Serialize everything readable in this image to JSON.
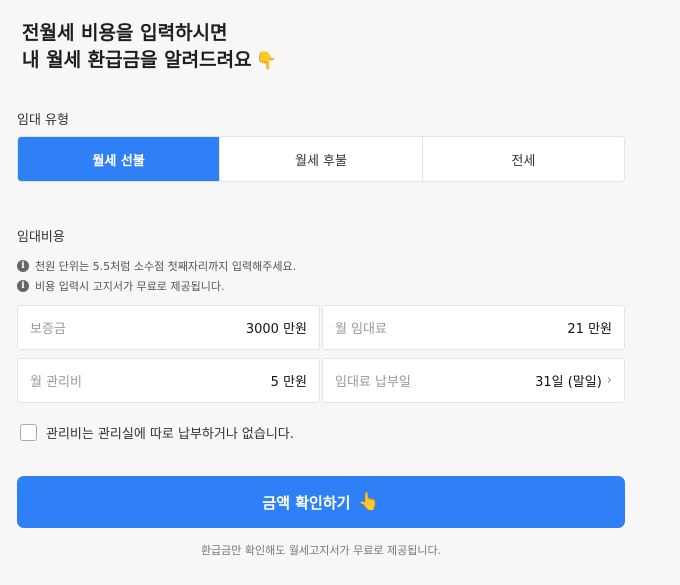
{
  "headline": {
    "line1": "전월세 비용을 입력하시면",
    "line2": "내 월세 환급금을 알려드려요",
    "emoji": "👇"
  },
  "rent_type": {
    "label": "임대 유형",
    "options": [
      "월세 선불",
      "월세 후불",
      "전세"
    ],
    "selected": "월세 선불"
  },
  "cost": {
    "label": "임대비용",
    "notes": [
      "천원 단위는 5.5처럼 소수점 첫째자리까지 입력해주세요.",
      "비용 입력시 고지서가 무료로 제공됩니다."
    ],
    "fields": {
      "deposit": {
        "label": "보증금",
        "value": "3000 만원"
      },
      "monthly_rent": {
        "label": "월 임대료",
        "value": "21 만원"
      },
      "maintenance": {
        "label": "월 관리비",
        "value": "5 만원"
      },
      "payment_day": {
        "label": "임대료 납부일",
        "value": "31일 (말일)"
      }
    }
  },
  "checkbox": {
    "label": "관리비는 관리실에 따로 납부하거나 없습니다.",
    "checked": false
  },
  "cta": {
    "label": "금액 확인하기",
    "emoji": "👆"
  },
  "footnote": "환급금만 확인해도 월세고지서가 무료로 제공됩니다.",
  "colors": {
    "accent": "#2f80f6",
    "background": "#f7f7f8"
  }
}
